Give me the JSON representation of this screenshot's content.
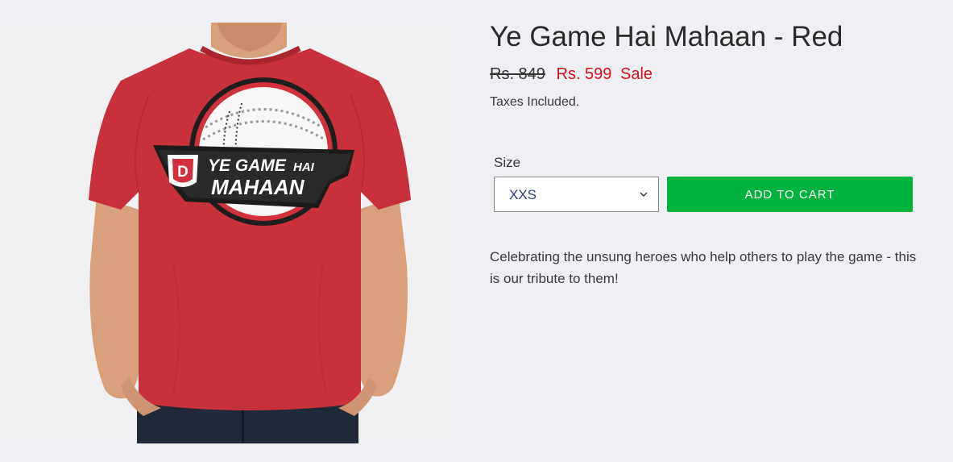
{
  "product": {
    "title": "Ye Game Hai Mahaan - Red",
    "image_alt": "Red t-shirt with Ye Game Hai Mahaan cricket ball print",
    "print_lines": [
      "YE GAME",
      "HAI",
      "MAHAAN"
    ],
    "print_logo_letter": "D",
    "price_regular": "Rs. 849",
    "price_sale": "Rs. 599",
    "sale_badge": "Sale",
    "tax_note": "Taxes Included.",
    "description": "Celebrating the unsung heroes who help others to play the game - this is our tribute to them!"
  },
  "variant": {
    "label": "Size",
    "selected": "XXS",
    "chevron_icon": "chevron-down-icon"
  },
  "cart": {
    "button_label": "ADD TO CART"
  },
  "colors": {
    "background": "#efeff4",
    "sale_red": "#d1111b",
    "cart_green": "#00b33c",
    "shirt_red": "#c8313b",
    "select_text": "#2c3e6b"
  }
}
